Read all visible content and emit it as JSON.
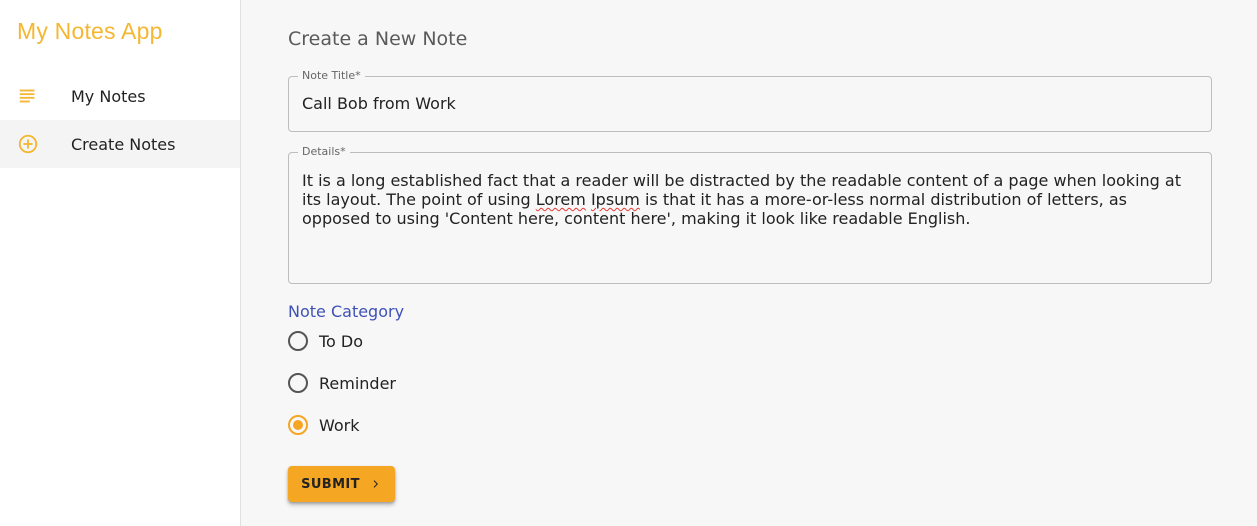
{
  "app": {
    "title": "My Notes App",
    "accent_color": "#f5b731"
  },
  "sidebar": {
    "items": [
      {
        "label": "My Notes",
        "icon": "subject-lines-icon",
        "active": false
      },
      {
        "label": "Create Notes",
        "icon": "add-circle-outline-icon",
        "active": true
      }
    ]
  },
  "main": {
    "title": "Create a New Note",
    "note_title": {
      "label": "Note Title",
      "required_marker": "*",
      "value": "Call Bob from Work"
    },
    "details": {
      "label": "Details",
      "required_marker": "*",
      "value_part1": "It is a long established fact that a reader will be distracted by the readable content of a page when looking at its layout. The point of using ",
      "value_word1": "Lorem",
      "value_space": " ",
      "value_word2": "Ipsum",
      "value_part2": " is that it has a more-or-less normal distribution of letters, as opposed to using 'Content here, content here', making it look like readable English."
    },
    "category": {
      "label": "Note Category",
      "label_color": "#3f51b5",
      "options": [
        {
          "label": "To Do",
          "checked": false
        },
        {
          "label": "Reminder",
          "checked": false
        },
        {
          "label": "Work",
          "checked": true
        }
      ]
    },
    "submit": {
      "label": "SUBMIT",
      "icon": "chevron-right-icon",
      "color": "#f5a623"
    }
  }
}
